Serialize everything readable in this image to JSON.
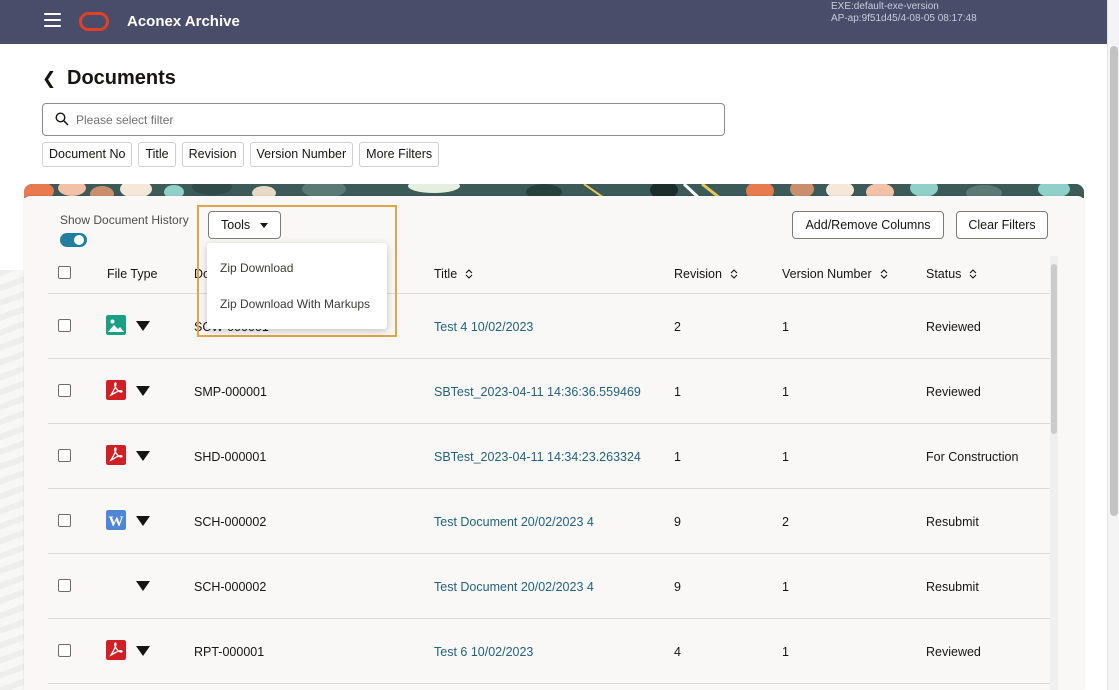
{
  "header": {
    "app_title": "Aconex Archive",
    "version_line1": "EXE:default-exe-version",
    "version_line2": "AP-ap:9f51d45/4-08-05 08:17:48",
    "brand_color": "#4a4d69",
    "logo_color": "#e0402a"
  },
  "page": {
    "title": "Documents",
    "back_icon": "chevron-left-icon"
  },
  "filter": {
    "placeholder": "Please select filter",
    "value": "",
    "icon": "search-icon",
    "chips": [
      "Document No",
      "Title",
      "Revision",
      "Version Number",
      "More Filters"
    ]
  },
  "toolbar": {
    "history_label": "Show Document History",
    "history_enabled": true,
    "tools_label": "Tools",
    "add_remove_label": "Add/Remove Columns",
    "clear_filters_label": "Clear Filters",
    "accent_color": "#227e9e"
  },
  "tools_menu": {
    "items": [
      "Zip Download",
      "Zip Download With Markups"
    ],
    "highlight_color": "#e0a54b"
  },
  "table": {
    "columns": {
      "file_type": "File Type",
      "document_no": "Do",
      "title": "Title",
      "revision": "Revision",
      "version_number": "Version Number",
      "status": "Status"
    },
    "rows": [
      {
        "file_type": "image-icon",
        "document_no": "SCW-000001",
        "title": "Test 4 10/02/2023",
        "revision": "2",
        "version": "1",
        "status": "Reviewed"
      },
      {
        "file_type": "pdf-icon",
        "document_no": "SMP-000001",
        "title": "SBTest_2023-04-11 14:36:36.559469",
        "revision": "1",
        "version": "1",
        "status": "Reviewed"
      },
      {
        "file_type": "pdf-icon",
        "document_no": "SHD-000001",
        "title": "SBTest_2023-04-11 14:34:23.263324",
        "revision": "1",
        "version": "1",
        "status": "For Construction"
      },
      {
        "file_type": "word-icon",
        "document_no": "SCH-000002",
        "title": "Test Document 20/02/2023 4",
        "revision": "9",
        "version": "2",
        "status": "Resubmit"
      },
      {
        "file_type": "",
        "document_no": "SCH-000002",
        "title": "Test Document 20/02/2023 4",
        "revision": "9",
        "version": "1",
        "status": "Resubmit"
      },
      {
        "file_type": "pdf-icon",
        "document_no": "RPT-000001",
        "title": "Test 6 10/02/2023",
        "revision": "4",
        "version": "1",
        "status": "Reviewed"
      }
    ]
  }
}
